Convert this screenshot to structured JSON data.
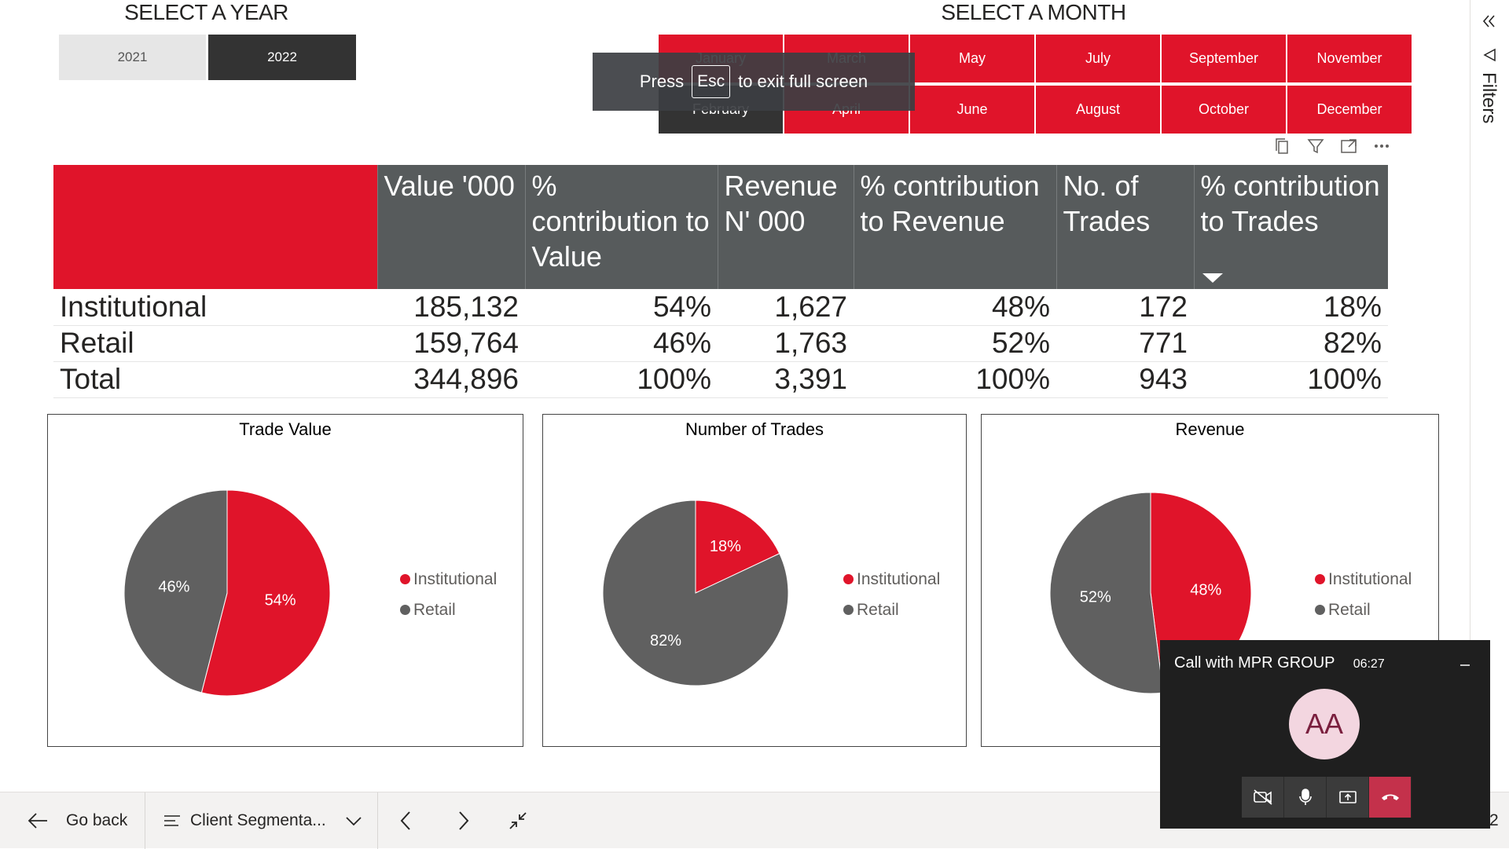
{
  "year_selector": {
    "heading": "SELECT A YEAR",
    "years": [
      {
        "label": "2021",
        "selected": false
      },
      {
        "label": "2022",
        "selected": true
      }
    ]
  },
  "month_selector": {
    "heading": "SELECT A MONTH",
    "months": [
      "January",
      "February",
      "March",
      "April",
      "May",
      "June",
      "July",
      "August",
      "September",
      "October",
      "November",
      "December"
    ]
  },
  "fullscreen_toast": {
    "before": "Press",
    "key": "Esc",
    "after": "to exit full screen"
  },
  "visual_header_icons": [
    "copy-icon",
    "filter-icon",
    "focus-mode-icon",
    "more-options-icon"
  ],
  "matrix": {
    "columns": [
      "Value '000",
      "% contribution to Value",
      "Revenue N' 000",
      "% contribution to Revenue",
      "No. of Trades",
      "% contribution to Trades"
    ],
    "rows": [
      {
        "label": "Institutional",
        "cells": [
          "185,132",
          "54%",
          "1,627",
          "48%",
          "172",
          "18%"
        ]
      },
      {
        "label": "Retail",
        "cells": [
          "159,764",
          "46%",
          "1,763",
          "52%",
          "771",
          "82%"
        ]
      },
      {
        "label": "Total",
        "cells": [
          "344,896",
          "100%",
          "3,391",
          "100%",
          "943",
          "100%"
        ]
      }
    ]
  },
  "chart_data": [
    {
      "type": "pie",
      "title": "Trade Value",
      "categories": [
        "Institutional",
        "Retail"
      ],
      "values": [
        54,
        46
      ],
      "labels": [
        "54%",
        "46%"
      ],
      "colors": [
        "#e0142a",
        "#606060"
      ],
      "legend": "right"
    },
    {
      "type": "pie",
      "title": "Number of Trades",
      "categories": [
        "Institutional",
        "Retail"
      ],
      "values": [
        18,
        82
      ],
      "labels": [
        "18%",
        "82%"
      ],
      "colors": [
        "#e0142a",
        "#606060"
      ],
      "legend": "right"
    },
    {
      "type": "pie",
      "title": "Revenue",
      "categories": [
        "Institutional",
        "Retail"
      ],
      "values": [
        48,
        52
      ],
      "labels": [
        "48%",
        "52%"
      ],
      "colors": [
        "#e0142a",
        "#606060"
      ],
      "legend": "right"
    }
  ],
  "bottom_bar": {
    "go_back": "Go back",
    "page_name": "Client Segmenta...",
    "page_number_fragment": "2"
  },
  "filters_pane": {
    "label": "Filters"
  },
  "call_window": {
    "title": "Call with MPR GROUP",
    "duration": "06:27",
    "avatar_initials": "AA"
  },
  "colors": {
    "accent_red": "#e0142a",
    "header_gray": "#575b5c",
    "retail_gray": "#606060",
    "selected_dark": "#333333"
  }
}
